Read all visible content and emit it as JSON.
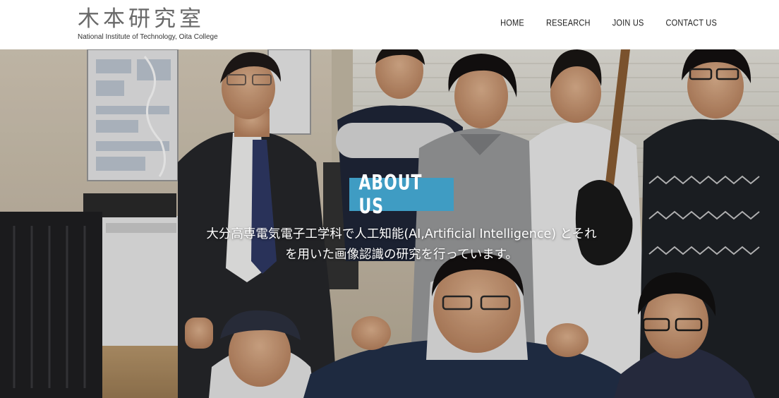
{
  "site": {
    "logo_jp": "木本研究室",
    "logo_en": "National Institute of Technology, Oita College"
  },
  "nav": {
    "items": [
      {
        "label": "HOME"
      },
      {
        "label": "RESEARCH"
      },
      {
        "label": "JOIN US"
      },
      {
        "label": "CONTACT US"
      }
    ]
  },
  "hero": {
    "heading": "ABOUT US",
    "description": "大分高専電気電子工学科で人工知能(AI,Artificial Intelligence) とそれを用いた画像認識の研究を行っています。",
    "colors": {
      "badge": "#3f9cc3",
      "text": "#ffffff"
    }
  }
}
